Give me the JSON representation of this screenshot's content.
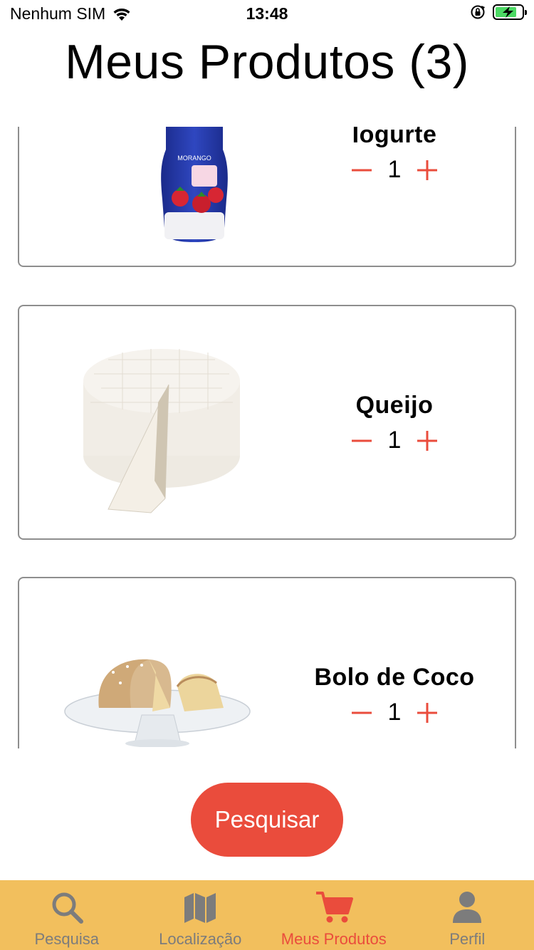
{
  "status_bar": {
    "carrier": "Nenhum SIM",
    "time": "13:48",
    "battery_level": 0.8
  },
  "page": {
    "title": "Meus Produtos (3)"
  },
  "products": [
    {
      "name": "Iogurte",
      "quantity": "1",
      "image": "yogurt-bottle"
    },
    {
      "name": "Queijo",
      "quantity": "1",
      "image": "cheese-wheel"
    },
    {
      "name": "Bolo de Coco",
      "quantity": "1",
      "image": "coconut-cake"
    }
  ],
  "search_button": {
    "label": "Pesquisar"
  },
  "tabs": [
    {
      "label": "Pesquisa",
      "icon": "search-icon",
      "active": false
    },
    {
      "label": "Localização",
      "icon": "map-icon",
      "active": false
    },
    {
      "label": "Meus Produtos",
      "icon": "cart-icon",
      "active": true
    },
    {
      "label": "Perfil",
      "icon": "person-icon",
      "active": false
    }
  ],
  "colors": {
    "accent": "#ea4c3c",
    "tabbar": "#f2bf5d",
    "inactive": "#7c7c7c",
    "card_border": "#8e8e8e"
  }
}
